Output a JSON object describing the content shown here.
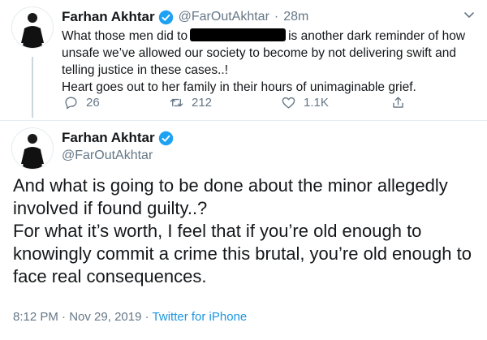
{
  "tweet1": {
    "author_name": "Farhan Akhtar",
    "handle": "@FarOutAkhtar",
    "separator": "·",
    "time": "28m",
    "text_line1_before": "What those men did to",
    "text_line1_after": "is another dark reminder of how",
    "text_rest": "unsafe we’ve allowed our society to become by not delivering swift and telling justice in these cases..!",
    "text_line4": "Heart goes out to her family in their hours of unimaginable grief.",
    "replies": "26",
    "retweets": "212",
    "likes": "1.1K"
  },
  "tweet2": {
    "author_name": "Farhan Akhtar",
    "handle": "@FarOutAkhtar",
    "text_p1": "And what is going to be done about the minor allegedly involved if found guilty..?",
    "text_p2": "For what it’s worth, I feel that if you’re old enough to knowingly commit a crime this brutal, you’re old enough to face real consequences.",
    "time": "8:12 PM",
    "separator1": "·",
    "date": "Nov 29, 2019",
    "separator2": "·",
    "source": "Twitter for iPhone"
  },
  "colors": {
    "text": "#14171a",
    "muted": "#657786",
    "link": "#1b95e0",
    "verified": "#1da1f2",
    "line": "#ccd6dd"
  }
}
